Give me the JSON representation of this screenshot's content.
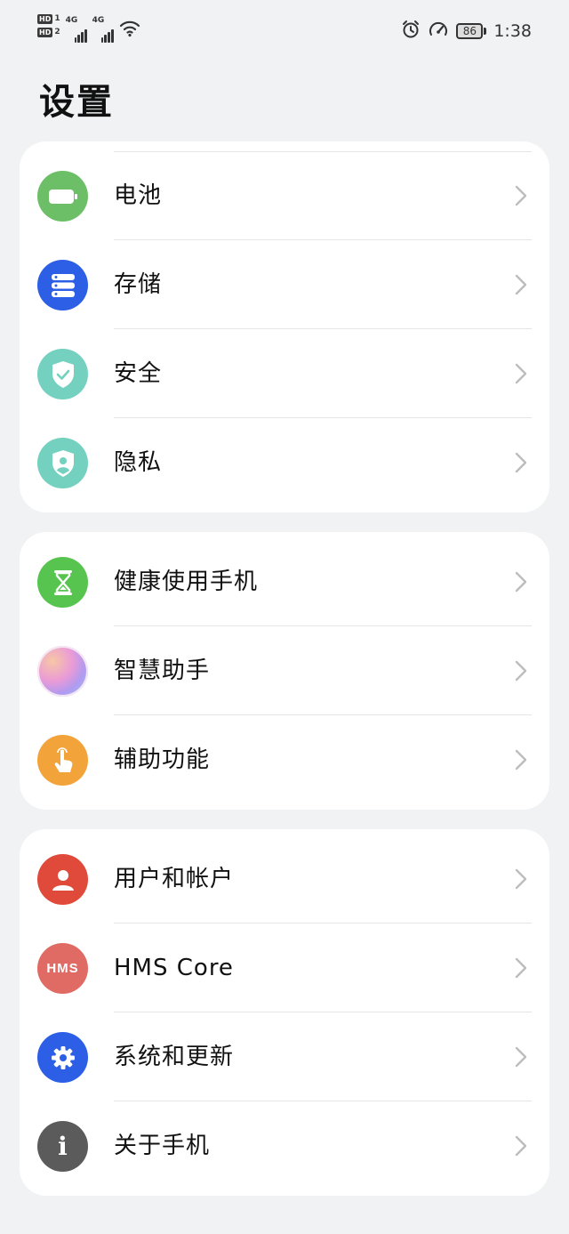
{
  "status_bar": {
    "sim1_tag": "HD",
    "sim1_num": "1",
    "sim2_tag": "HD",
    "sim2_num": "2",
    "net1": "4G",
    "net2": "4G",
    "battery": "86",
    "time": "1:38",
    "icons": [
      "alarm-icon",
      "data-saver-icon",
      "wifi-icon"
    ]
  },
  "page_title": "设置",
  "groups": [
    {
      "items": [
        {
          "label": "电池",
          "icon": "battery-icon",
          "color": "#6dbf67"
        },
        {
          "label": "存储",
          "icon": "storage-icon",
          "color": "#2c5ee6"
        },
        {
          "label": "安全",
          "icon": "shield-check-icon",
          "color": "#74d1bf"
        },
        {
          "label": "隐私",
          "icon": "privacy-shield-icon",
          "color": "#74d1bf"
        }
      ]
    },
    {
      "items": [
        {
          "label": "健康使用手机",
          "icon": "hourglass-icon",
          "color": "#57c44f"
        },
        {
          "label": "智慧助手",
          "icon": "assistant-gradient-icon",
          "color": "#e6a3d8"
        },
        {
          "label": "辅助功能",
          "icon": "hand-tap-icon",
          "color": "#f2a43a"
        }
      ]
    },
    {
      "items": [
        {
          "label": "用户和帐户",
          "icon": "user-icon",
          "color": "#e04a3a"
        },
        {
          "label": "HMS Core",
          "icon": "hms-icon",
          "icon_text": "HMS",
          "color": "#e06a64"
        },
        {
          "label": "系统和更新",
          "icon": "gear-icon",
          "color": "#2c5ee6"
        },
        {
          "label": "关于手机",
          "icon": "info-icon",
          "icon_text": "i",
          "color": "#5b5b5b"
        }
      ]
    }
  ]
}
